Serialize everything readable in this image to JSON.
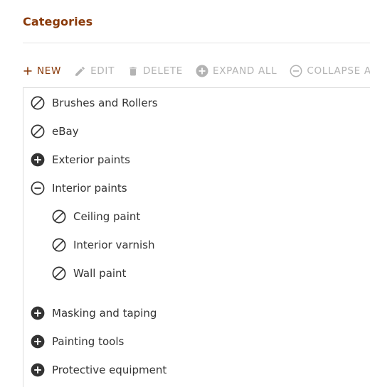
{
  "page": {
    "title": "Categories"
  },
  "toolbar": {
    "new_label": "NEW",
    "edit_label": "EDIT",
    "delete_label": "DELETE",
    "expand_label": "EXPAND ALL",
    "collapse_label": "COLLAPSE ALL"
  },
  "colors": {
    "accent": "#8a3a0a",
    "disabled": "#b3b3b3",
    "text": "#333333",
    "icon": "#333333"
  },
  "tree": {
    "items": [
      {
        "label": "Brushes and Rollers",
        "icon": "no-children-icon",
        "level": 0
      },
      {
        "label": "eBay",
        "icon": "no-children-icon",
        "level": 0
      },
      {
        "label": "Exterior paints",
        "icon": "expand-plus-icon",
        "level": 0
      },
      {
        "label": "Interior paints",
        "icon": "collapse-minus-icon",
        "level": 0
      },
      {
        "label": "Ceiling paint",
        "icon": "no-children-icon",
        "level": 1
      },
      {
        "label": "Interior varnish",
        "icon": "no-children-icon",
        "level": 1
      },
      {
        "label": "Wall paint",
        "icon": "no-children-icon",
        "level": 1
      },
      {
        "label": "Masking and taping",
        "icon": "expand-plus-icon",
        "level": 0
      },
      {
        "label": "Painting tools",
        "icon": "expand-plus-icon",
        "level": 0
      },
      {
        "label": "Protective equipment",
        "icon": "expand-plus-icon",
        "level": 0
      }
    ]
  }
}
